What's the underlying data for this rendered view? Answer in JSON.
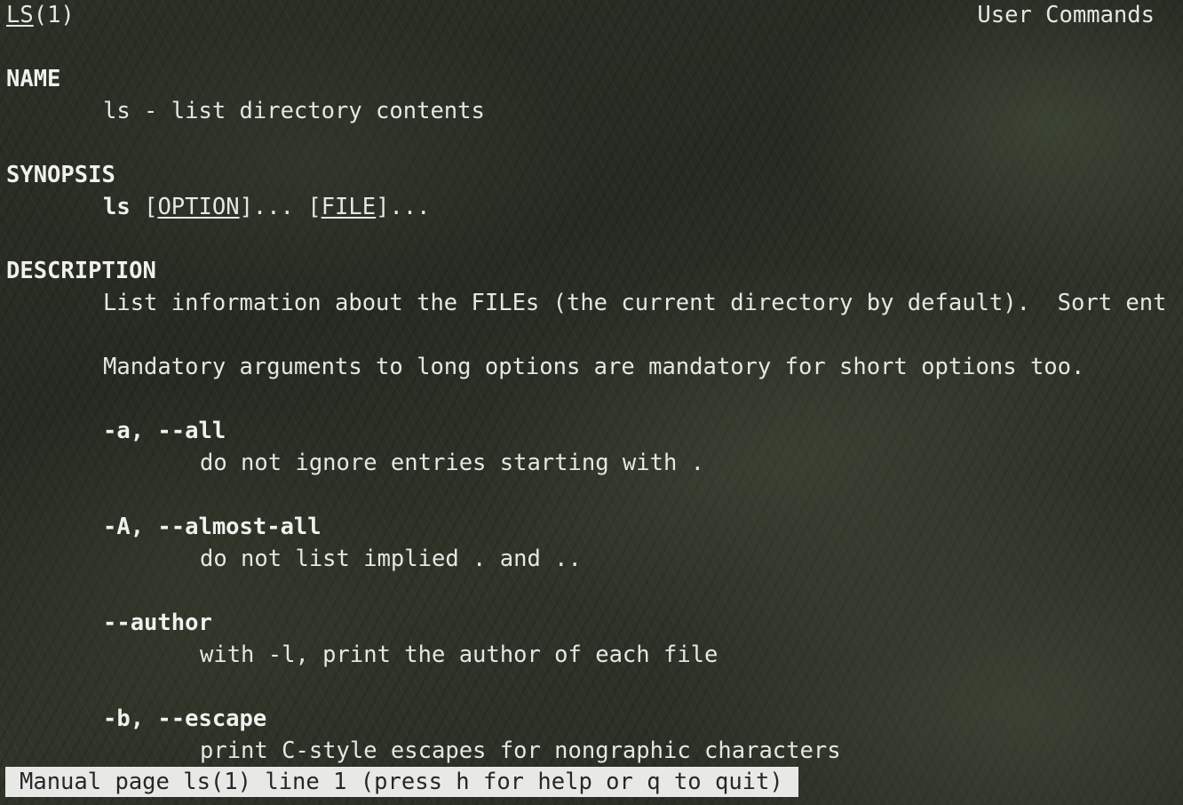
{
  "header": {
    "left_name": "LS",
    "left_section": "(1)",
    "right_title": "User Commands"
  },
  "name_section": {
    "heading": "NAME",
    "text": "ls - list directory contents"
  },
  "synopsis_section": {
    "heading": "SYNOPSIS",
    "command": "ls",
    "bracket_open_1": " [",
    "arg1": "OPTION",
    "after_arg1": "]... [",
    "arg2": "FILE",
    "after_arg2": "]..."
  },
  "description_section": {
    "heading": "DESCRIPTION",
    "line1": "List information about the FILEs (the current directory by default).  Sort ent",
    "line2": "Mandatory arguments to long options are mandatory for short options too."
  },
  "options": [
    {
      "flag": "-a, --all",
      "desc": "do not ignore entries starting with ."
    },
    {
      "flag": "-A, --almost-all",
      "desc": "do not list implied . and .."
    },
    {
      "flag": "--author",
      "desc": "with -l, print the author of each file"
    },
    {
      "flag": "-b, --escape",
      "desc": "print C-style escapes for nongraphic characters"
    }
  ],
  "status_bar": {
    "text": "Manual page ls(1) line 1 (press h for help or q to quit)"
  }
}
